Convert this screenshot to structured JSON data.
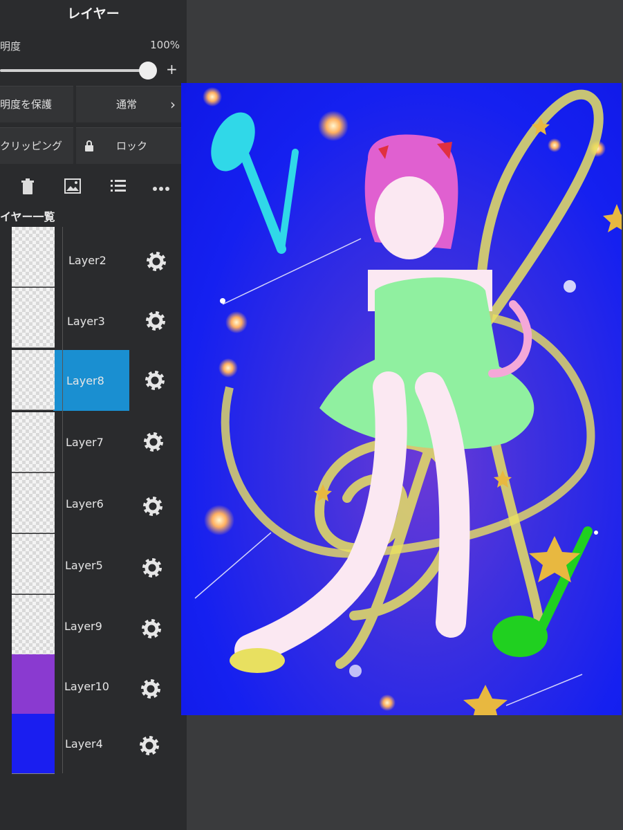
{
  "panel": {
    "title": "レイヤー",
    "opacity_label": "明度",
    "opacity_value": "100%",
    "opacity_level": 1.0,
    "protect_label": "明度を保護",
    "blend_mode": "通常",
    "clipping_label": "クリッピング",
    "lock_label": "ロック",
    "list_title": "イヤー一覧"
  },
  "toolbar": {
    "icons": [
      "trash-icon",
      "image-icon",
      "list-icon",
      "more-icon"
    ]
  },
  "layers": [
    {
      "name": "Layer2",
      "selected": false
    },
    {
      "name": "Layer3",
      "selected": false
    },
    {
      "name": "Layer8",
      "selected": true
    },
    {
      "name": "Layer7",
      "selected": false
    },
    {
      "name": "Layer6",
      "selected": false
    },
    {
      "name": "Layer5",
      "selected": false
    },
    {
      "name": "Layer9",
      "selected": false
    },
    {
      "name": "Layer10",
      "selected": false
    },
    {
      "name": "Layer4",
      "selected": false
    }
  ],
  "colors": {
    "accent": "#1a8fd1",
    "canvas_bg": "#1520f0",
    "clef": "#e8e060",
    "note_cyan": "#30d8e8",
    "note_green": "#20d020",
    "hair": "#e060d0",
    "dress": "#90f0a0"
  }
}
